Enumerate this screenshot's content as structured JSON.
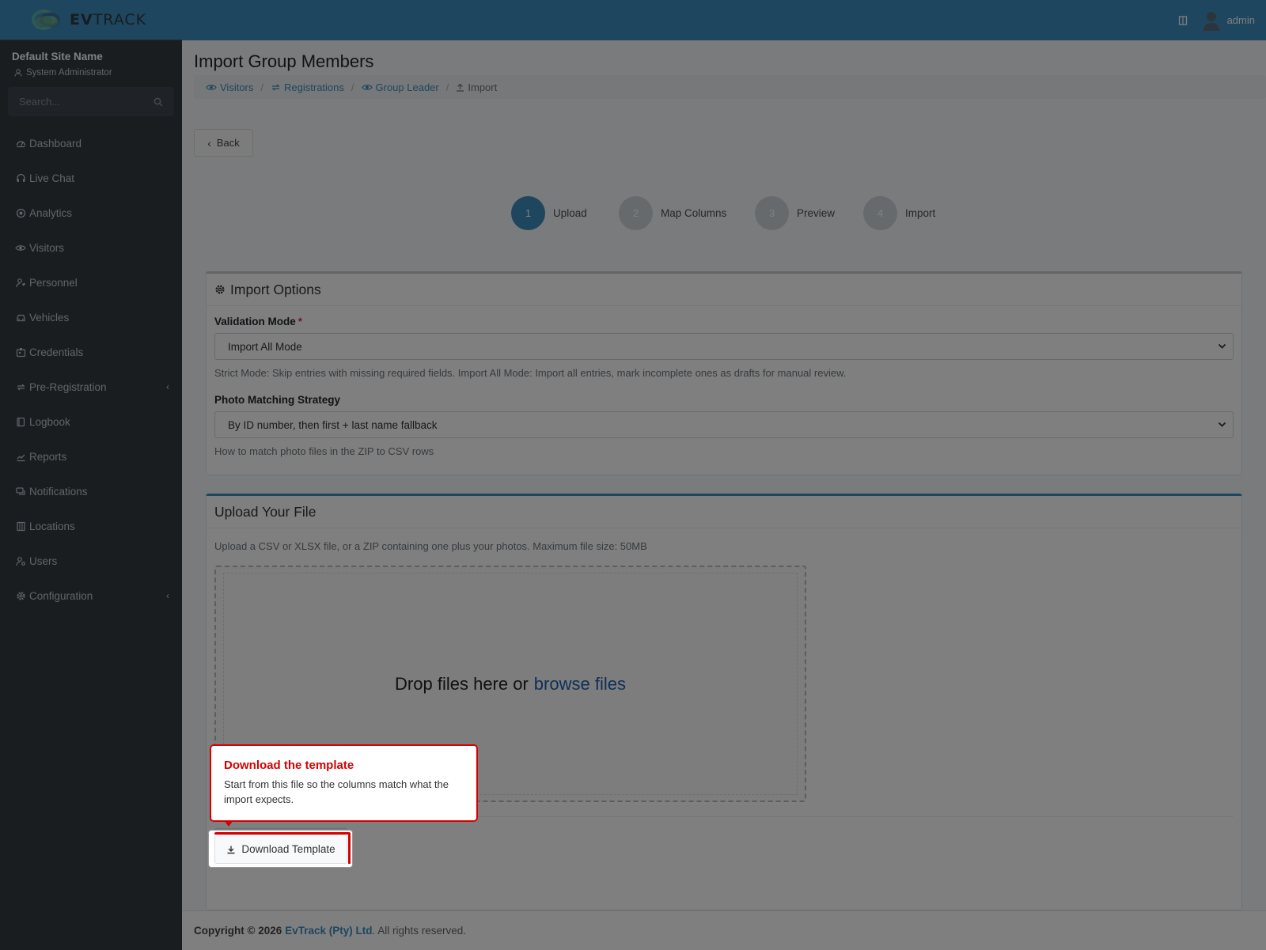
{
  "brand": {
    "name_bold": "EV",
    "name_light": "TRACK"
  },
  "sidebar": {
    "site_name": "Default Site Name",
    "user_role": "System Administrator",
    "search_placeholder": "Search...",
    "items": [
      {
        "label": "Dashboard",
        "icon": "dashboard-icon"
      },
      {
        "label": "Live Chat",
        "icon": "headset-icon"
      },
      {
        "label": "Analytics",
        "icon": "target-icon"
      },
      {
        "label": "Visitors",
        "icon": "eye-icon"
      },
      {
        "label": "Personnel",
        "icon": "user-tie-icon"
      },
      {
        "label": "Vehicles",
        "icon": "car-icon"
      },
      {
        "label": "Credentials",
        "icon": "id-badge-icon"
      },
      {
        "label": "Pre-Registration",
        "icon": "swap-icon",
        "expandable": true
      },
      {
        "label": "Logbook",
        "icon": "book-icon"
      },
      {
        "label": "Reports",
        "icon": "chart-icon"
      },
      {
        "label": "Notifications",
        "icon": "comments-icon"
      },
      {
        "label": "Locations",
        "icon": "building-icon"
      },
      {
        "label": "Users",
        "icon": "user-cog-icon"
      },
      {
        "label": "Configuration",
        "icon": "gear-icon",
        "expandable": true
      }
    ]
  },
  "topbar": {
    "username": "admin"
  },
  "page": {
    "title": "Import Group Members",
    "breadcrumb": [
      {
        "label": "Visitors",
        "icon": "eye-icon"
      },
      {
        "label": "Registrations",
        "icon": "swap-icon"
      },
      {
        "label": "Group Leader",
        "icon": "eye-icon"
      },
      {
        "label": "Import",
        "icon": "upload-icon"
      }
    ],
    "back_label": "Back"
  },
  "stepper": {
    "steps": [
      {
        "number": "1",
        "label": "Upload",
        "active": true
      },
      {
        "number": "2",
        "label": "Map Columns",
        "active": false
      },
      {
        "number": "3",
        "label": "Preview",
        "active": false
      },
      {
        "number": "4",
        "label": "Import",
        "active": false
      }
    ]
  },
  "import_options": {
    "title": "Import Options",
    "validation_label": "Validation Mode",
    "validation_required": "*",
    "validation_value": "Import All Mode",
    "validation_help": "Strict Mode: Skip entries with missing required fields. Import All Mode: Import all entries, mark incomplete ones as drafts for manual review.",
    "photo_label": "Photo Matching Strategy",
    "photo_value": "By ID number, then first + last name fallback",
    "photo_help": "How to match photo files in the ZIP to CSV rows"
  },
  "upload": {
    "title": "Upload Your File",
    "help": "Upload a CSV or XLSX file, or a ZIP containing one plus your photos. Maximum file size: 50MB",
    "drop_text": "Drop files here or",
    "browse_link": "browse files",
    "download_label": "Download Template"
  },
  "tooltip": {
    "title": "Download the template",
    "text": "Start from this file so the columns match what the import expects."
  },
  "footer": {
    "copyright": "Copyright © 2026",
    "company": "EvTrack (Pty) Ltd",
    "rights": ". All rights reserved."
  },
  "colors": {
    "primary": "#3c8dbc",
    "sidebar": "#343a40",
    "tooltip_accent": "#d70000"
  }
}
